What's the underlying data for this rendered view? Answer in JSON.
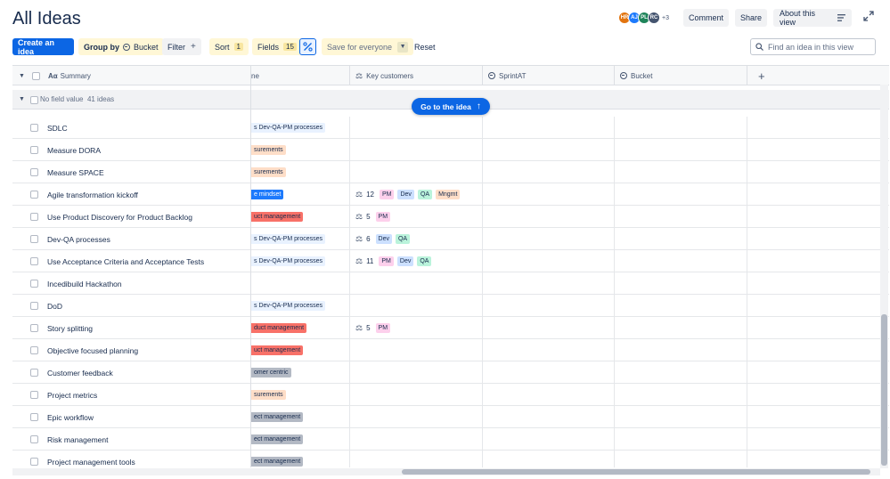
{
  "header": {
    "title": "All Ideas",
    "avatars": [
      {
        "initials": "HR",
        "color": "#e2740f"
      },
      {
        "initials": "AJ",
        "color": "#1d7afc"
      },
      {
        "initials": "PL",
        "color": "#1f845a"
      },
      {
        "initials": "RC",
        "color": "#44546f"
      }
    ],
    "avatars_more": "+3",
    "comment_label": "Comment",
    "share_label": "Share",
    "about_label": "About this view"
  },
  "toolbar": {
    "create_label": "Create an idea",
    "group_by_label": "Group by",
    "group_by_value": "Bucket",
    "filter_label": "Filter",
    "sort_label": "Sort",
    "sort_count": "1",
    "fields_label": "Fields",
    "fields_count": "15",
    "save_label": "Save for everyone",
    "reset_label": "Reset",
    "search_placeholder": "Find an idea in this view"
  },
  "columns": {
    "summary": "Summary",
    "summary_prefix": "Aα",
    "goal": "ne",
    "key_customers": "Key customers",
    "sprint": "SprintAT",
    "bucket": "Bucket"
  },
  "group": {
    "label": "No field value",
    "count": "41 ideas"
  },
  "go_to_idea_label": "Go to the idea",
  "rows": [
    {
      "summary": "SDLC",
      "goal": "s Dev-QA-PM processes",
      "goal_color": "#e9f2ff",
      "kc_count": "",
      "kc_tags": []
    },
    {
      "summary": "Measure DORA",
      "goal": "surements",
      "goal_color": "#fedec8",
      "kc_count": "",
      "kc_tags": []
    },
    {
      "summary": "Measure SPACE",
      "goal": "surements",
      "goal_color": "#fedec8",
      "kc_count": "",
      "kc_tags": []
    },
    {
      "summary": "Agile transformation kickoff",
      "goal": "e mindset",
      "goal_color": "#1d7afc",
      "goal_text_color": "#ffffff",
      "kc_count": "12",
      "kc_tags": [
        "PM",
        "Dev",
        "QA",
        "Mngmt"
      ]
    },
    {
      "summary": "Use Product Discovery for Product Backlog",
      "goal": "uct management",
      "goal_color": "#f87168",
      "kc_count": "5",
      "kc_tags": [
        "PM"
      ]
    },
    {
      "summary": "Dev-QA processes",
      "goal": "s Dev-QA-PM processes",
      "goal_color": "#e9f2ff",
      "kc_count": "6",
      "kc_tags": [
        "Dev",
        "QA"
      ]
    },
    {
      "summary": "Use Acceptance Criteria and Acceptance Tests",
      "goal": "s Dev-QA-PM processes",
      "goal_color": "#e9f2ff",
      "kc_count": "11",
      "kc_tags": [
        "PM",
        "Dev",
        "QA"
      ]
    },
    {
      "summary": "Incedibuild Hackathon",
      "goal": "",
      "goal_color": "",
      "kc_count": "",
      "kc_tags": []
    },
    {
      "summary": "DoD",
      "goal": "s Dev-QA-PM processes",
      "goal_color": "#e9f2ff",
      "kc_count": "",
      "kc_tags": []
    },
    {
      "summary": "Story splitting",
      "goal": "duct management",
      "goal_color": "#f87168",
      "kc_count": "5",
      "kc_tags": [
        "PM"
      ]
    },
    {
      "summary": "Objective focused planning",
      "goal": "uct management",
      "goal_color": "#f87168",
      "kc_count": "",
      "kc_tags": []
    },
    {
      "summary": "Customer feedback",
      "goal": "omer centric",
      "goal_color": "#b3b9c4",
      "kc_count": "",
      "kc_tags": []
    },
    {
      "summary": "Project metrics",
      "goal": "surements",
      "goal_color": "#fedec8",
      "kc_count": "",
      "kc_tags": []
    },
    {
      "summary": "Epic workflow",
      "goal": "ect management",
      "goal_color": "#b3b9c4",
      "kc_count": "",
      "kc_tags": []
    },
    {
      "summary": "Risk management",
      "goal": "ect management",
      "goal_color": "#b3b9c4",
      "kc_count": "",
      "kc_tags": []
    },
    {
      "summary": "Project management tools",
      "goal": "ect management",
      "goal_color": "#b3b9c4",
      "kc_count": "",
      "kc_tags": []
    }
  ],
  "tag_colors": {
    "PM": "#fdd0ec",
    "Dev": "#cce0ff",
    "QA": "#baf3db",
    "Mngmt": "#fedec8"
  }
}
